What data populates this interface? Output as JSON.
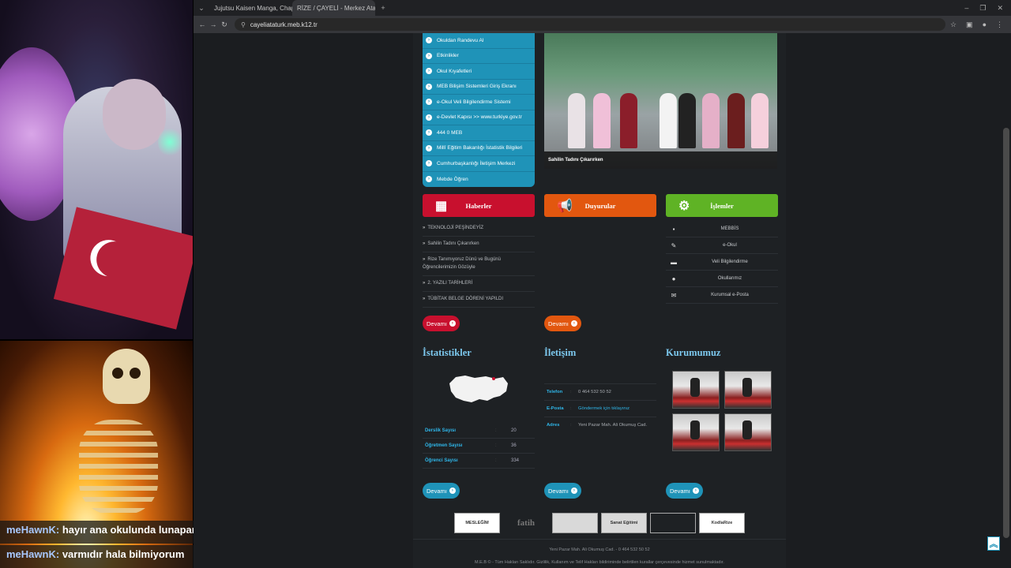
{
  "stream": {
    "chat": [
      {
        "user": "meHawnK:",
        "message": "hayır ana okulunda lunapark"
      },
      {
        "user": "meHawnK:",
        "message": "varmıdır hala bilmiyorum"
      }
    ]
  },
  "browser": {
    "tabs": [
      {
        "title": "Jujutsu Kaisen Manga, Chapter"
      },
      {
        "title": "RİZE / ÇAYELİ - Merkez Atatürk"
      }
    ],
    "new_tab": "+",
    "url": "cayeliataturk.meb.k12.tr"
  },
  "site": {
    "side_menu": [
      "Okuldan Randevu Al",
      "Etkinlikler",
      "Okul Kıyafetleri",
      "MEB Bilişim Sistemleri Giriş Ekranı",
      "e-Okul Veli Bilgilendirme Sistemi",
      "e-Devlet Kapısı >> www.turkiye.gov.tr",
      "444 0 MEB",
      "Millî Eğitim Bakanlığı İstatistik Bilgileri",
      "Cumhurbaşkanlığı İletişim Merkezi",
      "Mebde Öğren"
    ],
    "photo_caption": "Sahilin Tadını Çıkarırken",
    "panels": {
      "news": "Haberler",
      "announcements": "Duyurular",
      "operations": "İşlemler"
    },
    "news": [
      "TEKNOLOJİ PEŞİNDEYİZ",
      "Sahilin Tadını Çıkarırken",
      "Rize Tanımıyoruz Dünü ve Bugünü Öğrencilerimizin Gözüyle",
      "2. YAZILI TARİHLERİ",
      "TÜBİTAK BELGE DÖRENİ YAPILDI"
    ],
    "operations": [
      "MEBBİS",
      "e-Okul",
      "Veli Bilgilendirme",
      "Okullarımız",
      "Kurumsal e-Posta"
    ],
    "more_label": "Devamı",
    "stats_title": "İstatistikler",
    "contact_title": "İletişim",
    "institution_title": "Kurumumuz",
    "stats": [
      {
        "label": "Derslik Sayısı",
        "value": "20"
      },
      {
        "label": "Öğretmen Sayısı",
        "value": "36"
      },
      {
        "label": "Öğrenci Sayısı",
        "value": "334"
      }
    ],
    "contact": {
      "phone_label": "Telefon",
      "phone": "0 464 532 50 52",
      "email_label": "E-Posta",
      "email": "Göndermek için tıklayınız",
      "address_label": "Adres",
      "address": "Yeni Pazar Mah. Ali Okumuş Cad."
    },
    "logos": [
      "MESLEĞİM",
      "fatih",
      "",
      "Sanat Eğitimi",
      "",
      "KodlaRize"
    ],
    "footer_line1": "Yeni Pazar Mah. Ali Okumuş Cad. - 0 464 532 50 52",
    "footer_line2": "M.E.B © - Tüm Hakları Saklıdır. Gizlilik, Kullanım ve Telif Hakları bildiriminde belirtilen kurallar çerçevesinde hizmet sunulmaktadır.",
    "colors": {
      "menu": "#1f93b8",
      "news": "#c8102e",
      "announcements": "#e2570f",
      "operations": "#5fb325",
      "heading": "#7cc8ee"
    }
  }
}
